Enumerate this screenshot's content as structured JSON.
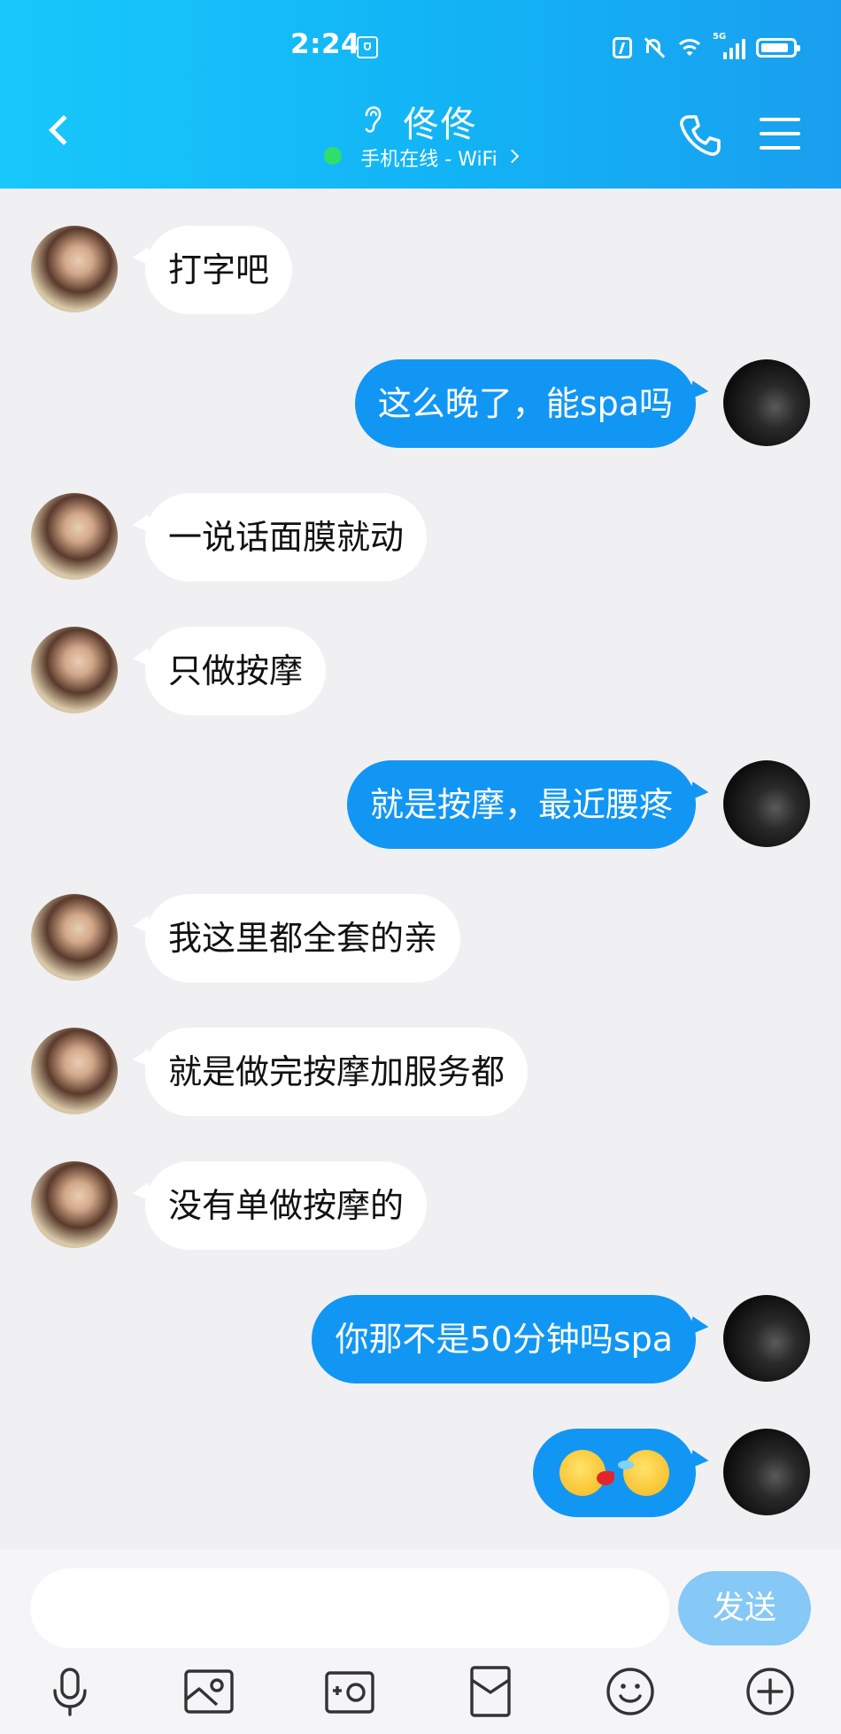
{
  "status_bar": {
    "time": "2:24",
    "network": "5G"
  },
  "header": {
    "contact_name": "佟佟",
    "online_status": "手机在线 - WiFi"
  },
  "messages": [
    {
      "side": "in",
      "text": "打字吧"
    },
    {
      "side": "out",
      "text": "这么晚了，能spa吗"
    },
    {
      "side": "in",
      "text": "一说话面膜就动"
    },
    {
      "side": "in",
      "text": "只做按摩"
    },
    {
      "side": "out",
      "text": "就是按摩，最近腰疼"
    },
    {
      "side": "in",
      "text": "我这里都全套的亲"
    },
    {
      "side": "in",
      "text": "就是做完按摩加服务都"
    },
    {
      "side": "in",
      "text": "没有单做按摩的"
    },
    {
      "side": "out",
      "text": "你那不是50分钟吗spa"
    },
    {
      "side": "out",
      "emoji": [
        "spitting-blood-face",
        "crying-face"
      ]
    }
  ],
  "input": {
    "value": "",
    "send_label": "发送"
  },
  "toolbar": [
    "voice-icon",
    "image-icon",
    "camera-icon",
    "red-packet-icon",
    "emoji-icon",
    "plus-icon"
  ],
  "colors": {
    "header": "#12b3f5",
    "out_bubble": "#1296f4",
    "in_bubble": "#ffffff",
    "send_button": "#86c8f6",
    "online": "#2ee06b"
  }
}
